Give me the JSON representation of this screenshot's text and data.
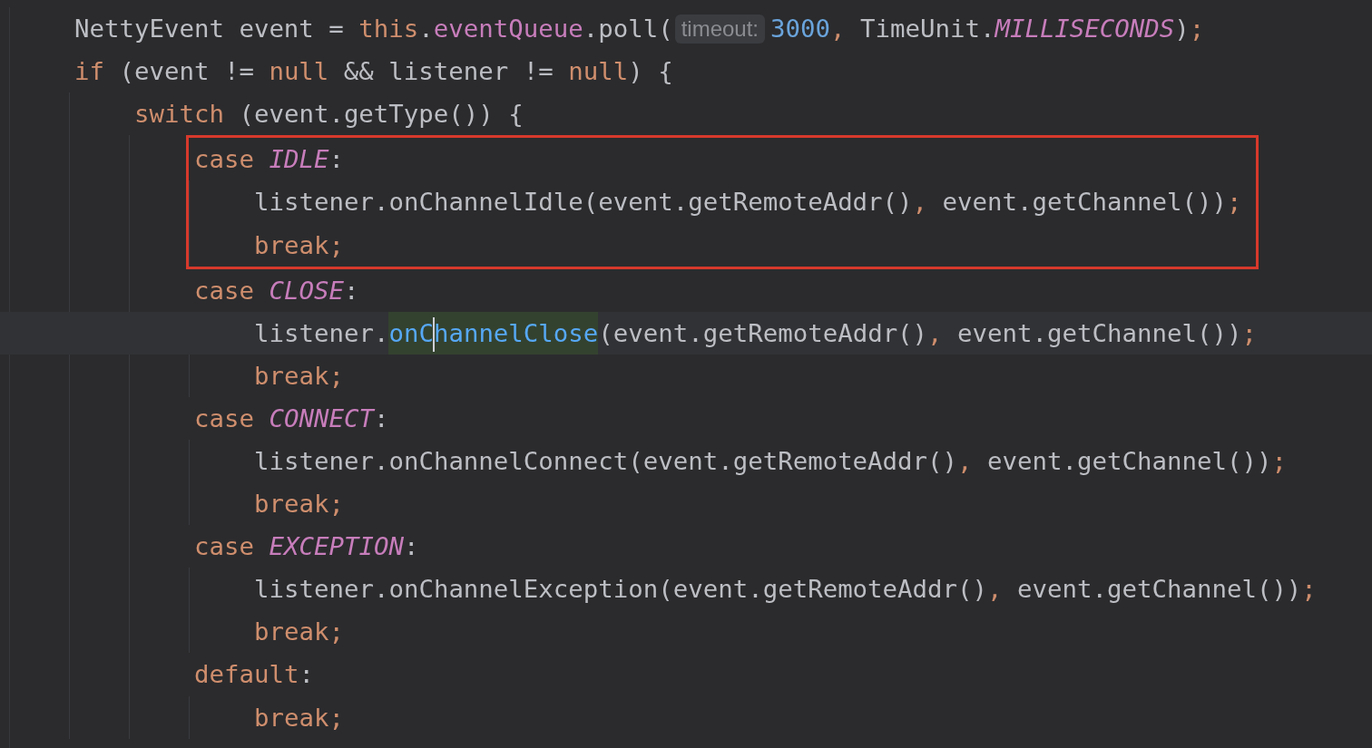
{
  "editor": {
    "lines": [
      {
        "segments": [
          {
            "kind": "code",
            "tokens": [
              {
                "kind": "plain",
                "text": "NettyEvent event = "
              },
              {
                "kind": "kw",
                "text": "this"
              },
              {
                "kind": "plain",
                "text": "."
              },
              {
                "kind": "field",
                "text": "eventQueue"
              },
              {
                "kind": "plain",
                "text": ".poll("
              }
            ]
          },
          {
            "kind": "hint",
            "text": "timeout:"
          },
          {
            "kind": "code",
            "tokens": [
              {
                "kind": "num",
                "text": "3000"
              },
              {
                "kind": "punct",
                "text": ","
              },
              {
                "kind": "plain",
                "text": " TimeUnit."
              },
              {
                "kind": "const",
                "text": "MILLISECONDS"
              },
              {
                "kind": "plain",
                "text": ")"
              },
              {
                "kind": "punct",
                "text": ";"
              }
            ]
          }
        ]
      },
      {
        "segments": [
          {
            "kind": "code",
            "tokens": [
              {
                "kind": "kw",
                "text": "if"
              },
              {
                "kind": "plain",
                "text": " (event != "
              },
              {
                "kind": "kw",
                "text": "null"
              },
              {
                "kind": "plain",
                "text": " && listener != "
              },
              {
                "kind": "kw",
                "text": "null"
              },
              {
                "kind": "plain",
                "text": ") {"
              }
            ]
          }
        ],
        "children": [
          {
            "segments": [
              {
                "kind": "code",
                "tokens": [
                  {
                    "kind": "kw",
                    "text": "switch"
                  },
                  {
                    "kind": "plain",
                    "text": " (event.getType()) {"
                  }
                ]
              }
            ],
            "children": [
              {
                "boxed": true,
                "segments": [
                  {
                    "kind": "code",
                    "tokens": [
                      {
                        "kind": "kw",
                        "text": "case"
                      },
                      {
                        "kind": "const",
                        "text": " IDLE"
                      },
                      {
                        "kind": "plain",
                        "text": ":"
                      }
                    ]
                  }
                ],
                "children": [
                  {
                    "segments": [
                      {
                        "kind": "code",
                        "tokens": [
                          {
                            "kind": "plain",
                            "text": "listener.onChannelIdle(event.getRemoteAddr()"
                          },
                          {
                            "kind": "punct",
                            "text": ","
                          },
                          {
                            "kind": "plain",
                            "text": " event.getChannel())"
                          },
                          {
                            "kind": "punct",
                            "text": ";"
                          }
                        ]
                      }
                    ]
                  },
                  {
                    "segments": [
                      {
                        "kind": "code",
                        "tokens": [
                          {
                            "kind": "kw",
                            "text": "break;"
                          }
                        ]
                      }
                    ]
                  }
                ]
              },
              {
                "boxed": false,
                "segments": [
                  {
                    "kind": "code",
                    "tokens": [
                      {
                        "kind": "kw",
                        "text": "case"
                      },
                      {
                        "kind": "const",
                        "text": " CLOSE"
                      },
                      {
                        "kind": "plain",
                        "text": ":"
                      }
                    ]
                  }
                ],
                "children": [
                  {
                    "current": true,
                    "segments": [
                      {
                        "kind": "code",
                        "tokens": [
                          {
                            "kind": "plain",
                            "text": "listener."
                          },
                          {
                            "kind": "usage",
                            "parts": [
                              "onC",
                              "hannelClose"
                            ]
                          },
                          {
                            "kind": "plain",
                            "text": "(event.getRemoteAddr()"
                          },
                          {
                            "kind": "punct",
                            "text": ","
                          },
                          {
                            "kind": "plain",
                            "text": " event.getChannel())"
                          },
                          {
                            "kind": "punct",
                            "text": ";"
                          }
                        ]
                      }
                    ]
                  },
                  {
                    "segments": [
                      {
                        "kind": "code",
                        "tokens": [
                          {
                            "kind": "kw",
                            "text": "break;"
                          }
                        ]
                      }
                    ]
                  }
                ]
              },
              {
                "boxed": false,
                "segments": [
                  {
                    "kind": "code",
                    "tokens": [
                      {
                        "kind": "kw",
                        "text": "case"
                      },
                      {
                        "kind": "const",
                        "text": " CONNECT"
                      },
                      {
                        "kind": "plain",
                        "text": ":"
                      }
                    ]
                  }
                ],
                "children": [
                  {
                    "segments": [
                      {
                        "kind": "code",
                        "tokens": [
                          {
                            "kind": "plain",
                            "text": "listener.onChannelConnect(event.getRemoteAddr()"
                          },
                          {
                            "kind": "punct",
                            "text": ","
                          },
                          {
                            "kind": "plain",
                            "text": " event.getChannel())"
                          },
                          {
                            "kind": "punct",
                            "text": ";"
                          }
                        ]
                      }
                    ]
                  },
                  {
                    "segments": [
                      {
                        "kind": "code",
                        "tokens": [
                          {
                            "kind": "kw",
                            "text": "break;"
                          }
                        ]
                      }
                    ]
                  }
                ]
              },
              {
                "boxed": false,
                "segments": [
                  {
                    "kind": "code",
                    "tokens": [
                      {
                        "kind": "kw",
                        "text": "case"
                      },
                      {
                        "kind": "const",
                        "text": " EXCEPTION"
                      },
                      {
                        "kind": "plain",
                        "text": ":"
                      }
                    ]
                  }
                ],
                "children": [
                  {
                    "segments": [
                      {
                        "kind": "code",
                        "tokens": [
                          {
                            "kind": "plain",
                            "text": "listener.onChannelException(event.getRemoteAddr()"
                          },
                          {
                            "kind": "punct",
                            "text": ","
                          },
                          {
                            "kind": "plain",
                            "text": " event.getChannel())"
                          },
                          {
                            "kind": "punct",
                            "text": ";"
                          }
                        ]
                      }
                    ]
                  },
                  {
                    "segments": [
                      {
                        "kind": "code",
                        "tokens": [
                          {
                            "kind": "kw",
                            "text": "break;"
                          }
                        ]
                      }
                    ]
                  }
                ]
              },
              {
                "boxed": false,
                "segments": [
                  {
                    "kind": "code",
                    "tokens": [
                      {
                        "kind": "kw",
                        "text": "default"
                      },
                      {
                        "kind": "plain",
                        "text": ":"
                      }
                    ]
                  }
                ],
                "children": [
                  {
                    "segments": [
                      {
                        "kind": "code",
                        "tokens": [
                          {
                            "kind": "kw",
                            "text": "break;"
                          }
                        ]
                      }
                    ]
                  }
                ]
              }
            ]
          }
        ]
      }
    ]
  }
}
